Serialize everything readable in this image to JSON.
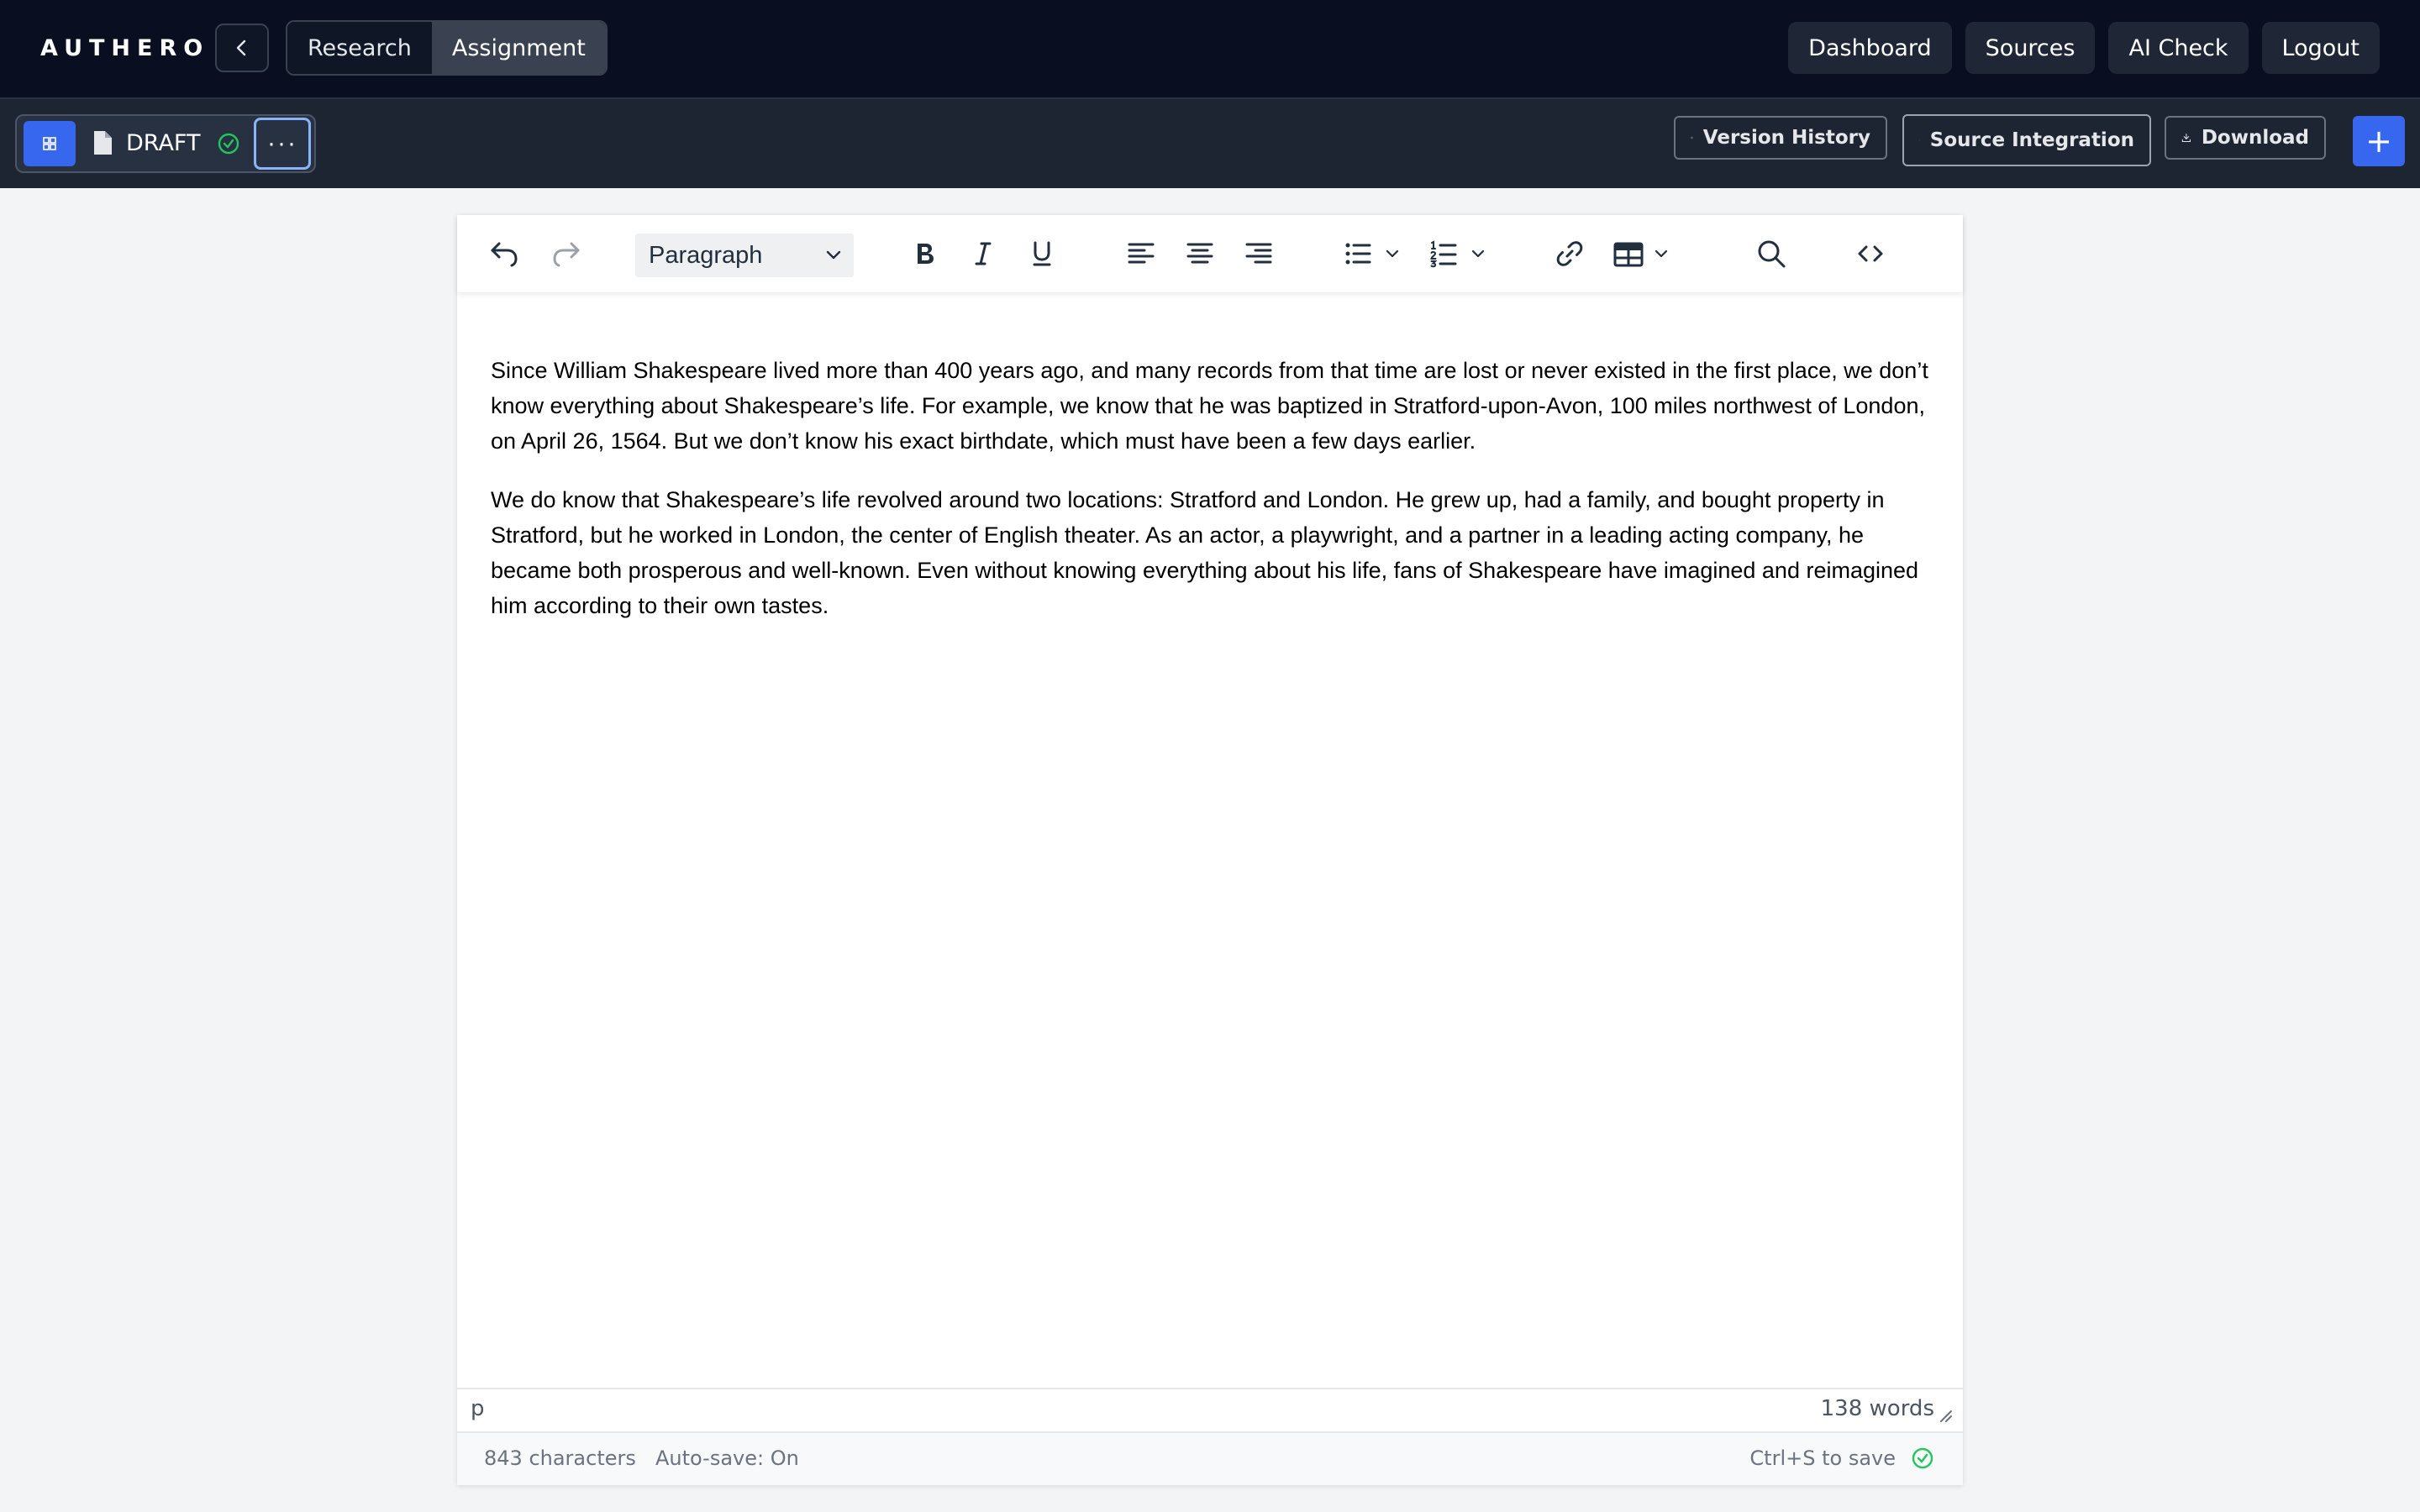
{
  "app": {
    "brand": "AUTHERO"
  },
  "topnav": {
    "tabs": [
      {
        "label": "Research",
        "active": false
      },
      {
        "label": "Assignment",
        "active": true
      }
    ],
    "actions": [
      {
        "label": "Dashboard"
      },
      {
        "label": "Sources"
      },
      {
        "label": "AI Check"
      },
      {
        "label": "Logout"
      }
    ]
  },
  "subbar": {
    "draft_label": "DRAFT",
    "more_label": "···",
    "version_history": "Version History",
    "source_integration": "Source Integration",
    "download": "Download",
    "add_label": "+"
  },
  "editor": {
    "block_format": "Paragraph",
    "paragraphs": [
      "Since William Shakespeare lived more than 400 years ago, and many records from that time are lost or never existed in the first place, we don’t know everything about Shakespeare’s life. For example, we know that he was baptized in Stratford-upon-Avon, 100 miles northwest of London, on April 26, 1564. But we don’t know his exact birthdate, which must have been a few days earlier.",
      "We do know that Shakespeare’s life revolved around two locations: Stratford and London. He grew up, had a family, and bought property in Stratford, but he worked in London, the center of English theater. As an actor, a playwright, and a partner in a leading acting company, he became both prosperous and well-known. Even without knowing everything about his life, fans of Shakespeare have imagined and reimagined him according to their own tastes."
    ],
    "element_path": "p",
    "word_count": "138 words"
  },
  "footer": {
    "characters": "843 characters",
    "autosave": "Auto-save: On",
    "save_hint": "Ctrl+S to save"
  },
  "colors": {
    "nav_bg": "#090f20",
    "subbar_bg": "#1e2532",
    "accent": "#3867ef",
    "success": "#22c55e",
    "page_bg": "#f3f4f6"
  }
}
